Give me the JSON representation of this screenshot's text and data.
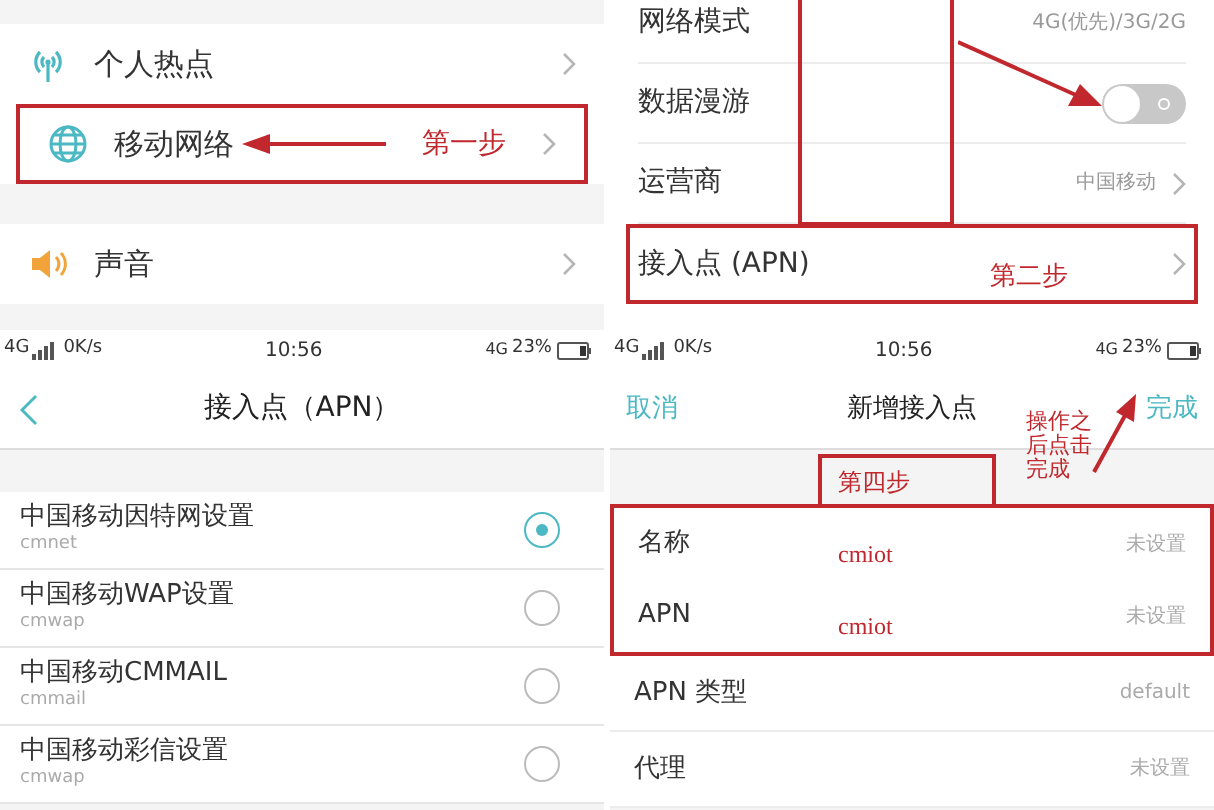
{
  "mobile_settings": {
    "items": [
      {
        "label": "个人热点",
        "highlighted": false
      },
      {
        "label": "移动网络",
        "highlighted": true,
        "annotation": "第一步"
      },
      {
        "label": "声音",
        "highlighted": false
      }
    ]
  },
  "network_settings": {
    "rows": [
      {
        "kind": "value",
        "label": "网络模式",
        "value": "4G(优先)/3G/2G",
        "highlighted": false
      },
      {
        "kind": "switch",
        "label": "数据漫游",
        "on": false,
        "highlighted": false
      },
      {
        "kind": "link",
        "label": "运营商",
        "value": "中国移动",
        "highlighted": false
      },
      {
        "kind": "link",
        "label": "接入点 (APN)",
        "highlighted": true,
        "annotation": "第二步"
      }
    ]
  },
  "apn_list": {
    "status_bar": {
      "network": "4G",
      "speed": "0K/s",
      "time": "10:56",
      "battery_network": "4G",
      "battery": "23%"
    },
    "title": "接入点（APN）",
    "items": [
      {
        "name": "中国移动因特网设置",
        "apn": "cmnet",
        "selected": true
      },
      {
        "name": "中国移动WAP设置",
        "apn": "cmwap",
        "selected": false
      },
      {
        "name": "中国移动CMMAIL",
        "apn": "cmmail",
        "selected": false
      },
      {
        "name": "中国移动彩信设置",
        "apn": "cmwap",
        "selected": false
      }
    ]
  },
  "new_apn": {
    "status_bar": {
      "network": "4G",
      "speed": "0K/s",
      "time": "10:56",
      "battery_network": "4G",
      "battery": "23%"
    },
    "cancel": "取消",
    "title": "新增接入点",
    "done": "完成",
    "step": "第四步",
    "done_note": "操作之后点击完成",
    "fields": [
      {
        "label": "名称",
        "value": "未设置",
        "annotation": "cmiot",
        "highlighted": true
      },
      {
        "label": "APN",
        "value": "未设置",
        "annotation": "cmiot",
        "highlighted": true
      },
      {
        "label": "APN 类型",
        "value": "default",
        "highlighted": false
      },
      {
        "label": "代理",
        "value": "未设置",
        "highlighted": false
      }
    ]
  }
}
